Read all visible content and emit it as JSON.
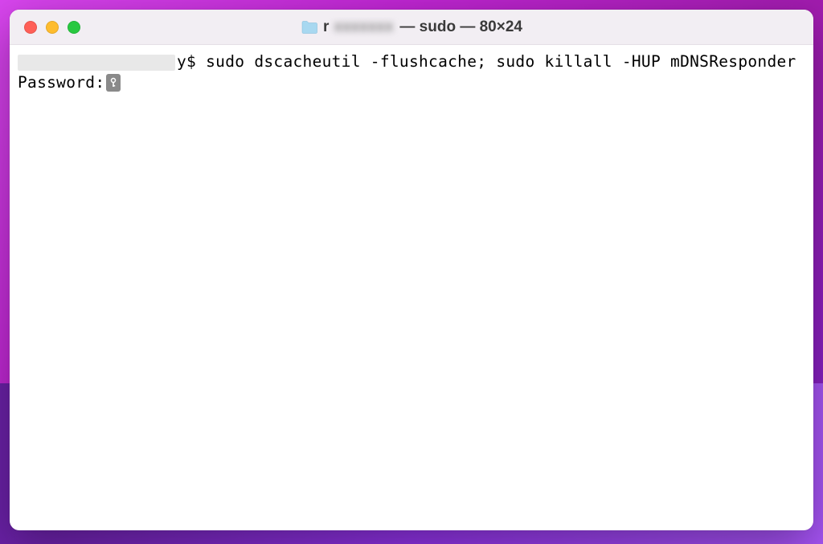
{
  "titlebar": {
    "folder_prefix": "r",
    "title_suffix": " — sudo — 80×24"
  },
  "terminal": {
    "prompt_suffix": "y$ ",
    "command": "sudo dscacheutil -flushcache; sudo killall -HUP mDNSResponder",
    "password_prompt": "Password:"
  }
}
